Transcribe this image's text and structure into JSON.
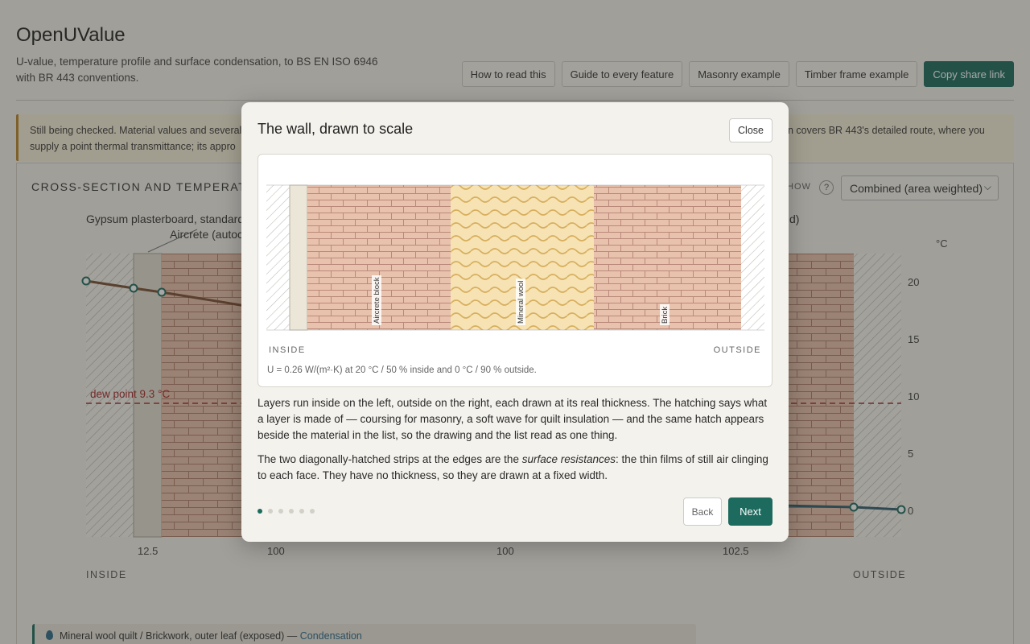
{
  "app": {
    "title": "OpenUValue",
    "subtitle": "U-value, temperature profile and surface condensation, to BS EN ISO 6946 with BR 443 conventions."
  },
  "toolbar": {
    "buttons": [
      "How to read this",
      "Guide to every feature",
      "Masonry example",
      "Timber frame example"
    ],
    "share_label": "Copy share link"
  },
  "notice": {
    "left_text": "Still being checked. Material values and several",
    "left_line2": "supply a point thermal transmittance; its appro",
    "right_text": "n covers BR 443's detailed route, where you"
  },
  "panel": {
    "title": "CROSS-SECTION AND TEMPERATUR",
    "show_label": "HOW",
    "help": "?",
    "view_select": "Combined (area weighted)",
    "layer_label_1": "Gypsum plasterboard, standard",
    "layer_label_2": "Aircrete (autoc",
    "layer_label_right": "d)",
    "unit": "°C",
    "dew_point": "dew point 9.3 °C",
    "y_ticks": [
      "20",
      "15",
      "10",
      "5",
      "0"
    ],
    "x_ticks": [
      "12.5",
      "100",
      "100",
      "102.5"
    ],
    "inside": "INSIDE",
    "outside": "OUTSIDE"
  },
  "condensation_bar": {
    "text": "Mineral wool quilt / Brickwork, outer leaf (exposed)",
    "sep": " — ",
    "link": "Condensation"
  },
  "modal": {
    "title": "The wall, drawn to scale",
    "close_label": "Close",
    "figure": {
      "layers": [
        {
          "name": "Plasterboard",
          "label": "",
          "thickness_mm": 12.5
        },
        {
          "name": "Aircrete block",
          "label": "Aircrete block",
          "thickness_mm": 100
        },
        {
          "name": "Mineral wool",
          "label": "Mineral wool",
          "thickness_mm": 100
        },
        {
          "name": "Brick",
          "label": "Brick",
          "thickness_mm": 102.5
        }
      ],
      "inside": "INSIDE",
      "outside": "OUTSIDE",
      "caption": "U = 0.26 W/(m²·K) at 20 °C / 50 % inside and 0 °C / 90 % outside."
    },
    "p1": "Layers run inside on the left, outside on the right, each drawn at its real thickness. The hatching says what a layer is made of — coursing for masonry, a soft wave for quilt insulation — and the same hatch appears beside the material in the list, so the drawing and the list read as one thing.",
    "p2_before": "The two diagonally-hatched strips at the edges are the ",
    "p2_em": "surface resistances",
    "p2_after": ": the thin films of still air clinging to each face. They have no thickness, so they are drawn at a fixed width.",
    "steps": {
      "total": 6,
      "current": 1
    },
    "back_label": "Back",
    "next_label": "Next"
  },
  "colors": {
    "accent": "#1d6b5f",
    "brick": "#e9c2ad",
    "insulation": "#f6e2b3",
    "dew_line": "#a62a2a"
  }
}
